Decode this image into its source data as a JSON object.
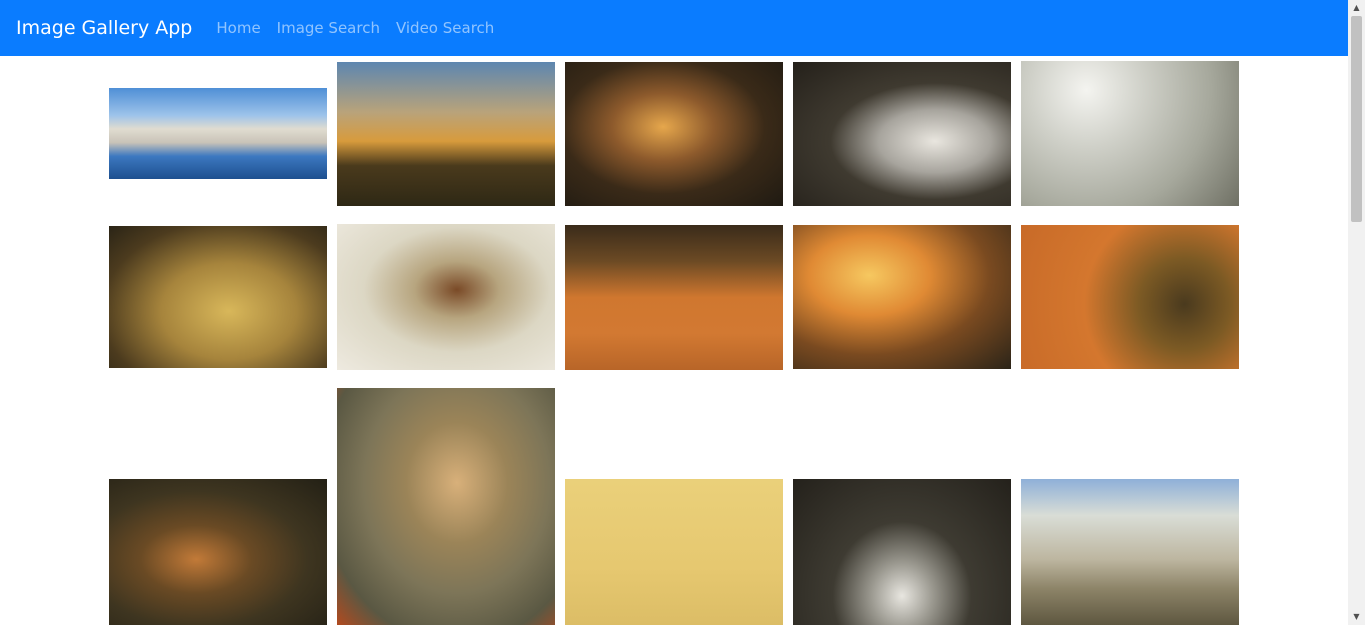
{
  "navbar": {
    "brand": "Image Gallery App",
    "links": [
      "Home",
      "Image Search",
      "Video Search"
    ]
  },
  "gallery": {
    "images": [
      {
        "name": "harbor-boats-image",
        "bg": "linear-gradient(180deg,#4f8fd6 0%,#9dc3ea 30%,#e0dcd0 45%,#c9c3b8 60%,#3c78c0 75%,#1d4f8f 100%)"
      },
      {
        "name": "sunset-tree-image",
        "bg": "linear-gradient(180deg,#5d86b0 0%,#b9a37a 35%,#d89b3c 55%,#4a3a1c 72%,#2e2815 100%)"
      },
      {
        "name": "cave-sunset-image",
        "bg": "radial-gradient(ellipse at 45% 45%,#e6a74c 0%,#8d5a2c 30%,#3a2a18 60%,#1f1a12 100%)"
      },
      {
        "name": "eagle-image",
        "bg": "radial-gradient(ellipse at 65% 55%,#e9e6df 0%,#a7a49d 28%,#3f3a30 52%,#24201a 100%)"
      },
      {
        "name": "moon-woman-image",
        "bg": "radial-gradient(circle at 30% 20%,#f4f4f0 0%,#cfd0c8 30%,#a6a89c 65%,#6f7064 100%)"
      },
      {
        "name": "autumn-leaves-image",
        "bg": "radial-gradient(ellipse at 55% 60%,#d8b75a 0%,#a6843c 40%,#4c3b1e 75%,#2a2416 100%)"
      },
      {
        "name": "butterfly-silk-image",
        "bg": "radial-gradient(ellipse at 55% 45%,#7a4a27 0%,#b7a57f 25%,#dcd7c4 55%,#eeeae0 100%)"
      },
      {
        "name": "cow-image",
        "bg": "linear-gradient(180deg,#3a2b1a 0%,#6c4a24 25%,#d0772f 50%,#d27932 75%,#b86528 100%)"
      },
      {
        "name": "sunset-landscape-image",
        "bg": "radial-gradient(ellipse at 35% 35%,#f6c860 0%,#e08a34 30%,#7a4a20 60%,#2b2418 100%)"
      },
      {
        "name": "bee-sunflower-image",
        "bg": "radial-gradient(circle at 75% 55%,#4a3a1e 0%,#7c5a24 25%,#d4772e 55%,#c86a28 100%)"
      },
      {
        "name": "tiger-image",
        "bg": "radial-gradient(ellipse at 40% 55%,#c27a38 0%,#6a4a24 30%,#3e3520 60%,#232015 100%)"
      },
      {
        "name": "butterfly-flower-image",
        "bg": "radial-gradient(ellipse at 55% 40%,#d8b07a 0%,#9b8458 30%,#7d7558 55%,#5a5843 80%,#b24a1f 100%)"
      },
      {
        "name": "boat-lake-image",
        "bg": "linear-gradient(180deg,#ead07a 0%,#e6c870 60%,#dcbd66 100%)"
      },
      {
        "name": "car-garage-image",
        "bg": "radial-gradient(ellipse at 50% 80%,#e8e6e0 0%,#9b9990 20%,#3e3b32 45%,#24211b 100%)"
      },
      {
        "name": "cloudy-shore-image",
        "bg": "linear-gradient(180deg,#8fb0d8 0%,#d9ddd6 25%,#bdb6a0 55%,#8d8468 75%,#5e5740 100%)"
      }
    ]
  }
}
